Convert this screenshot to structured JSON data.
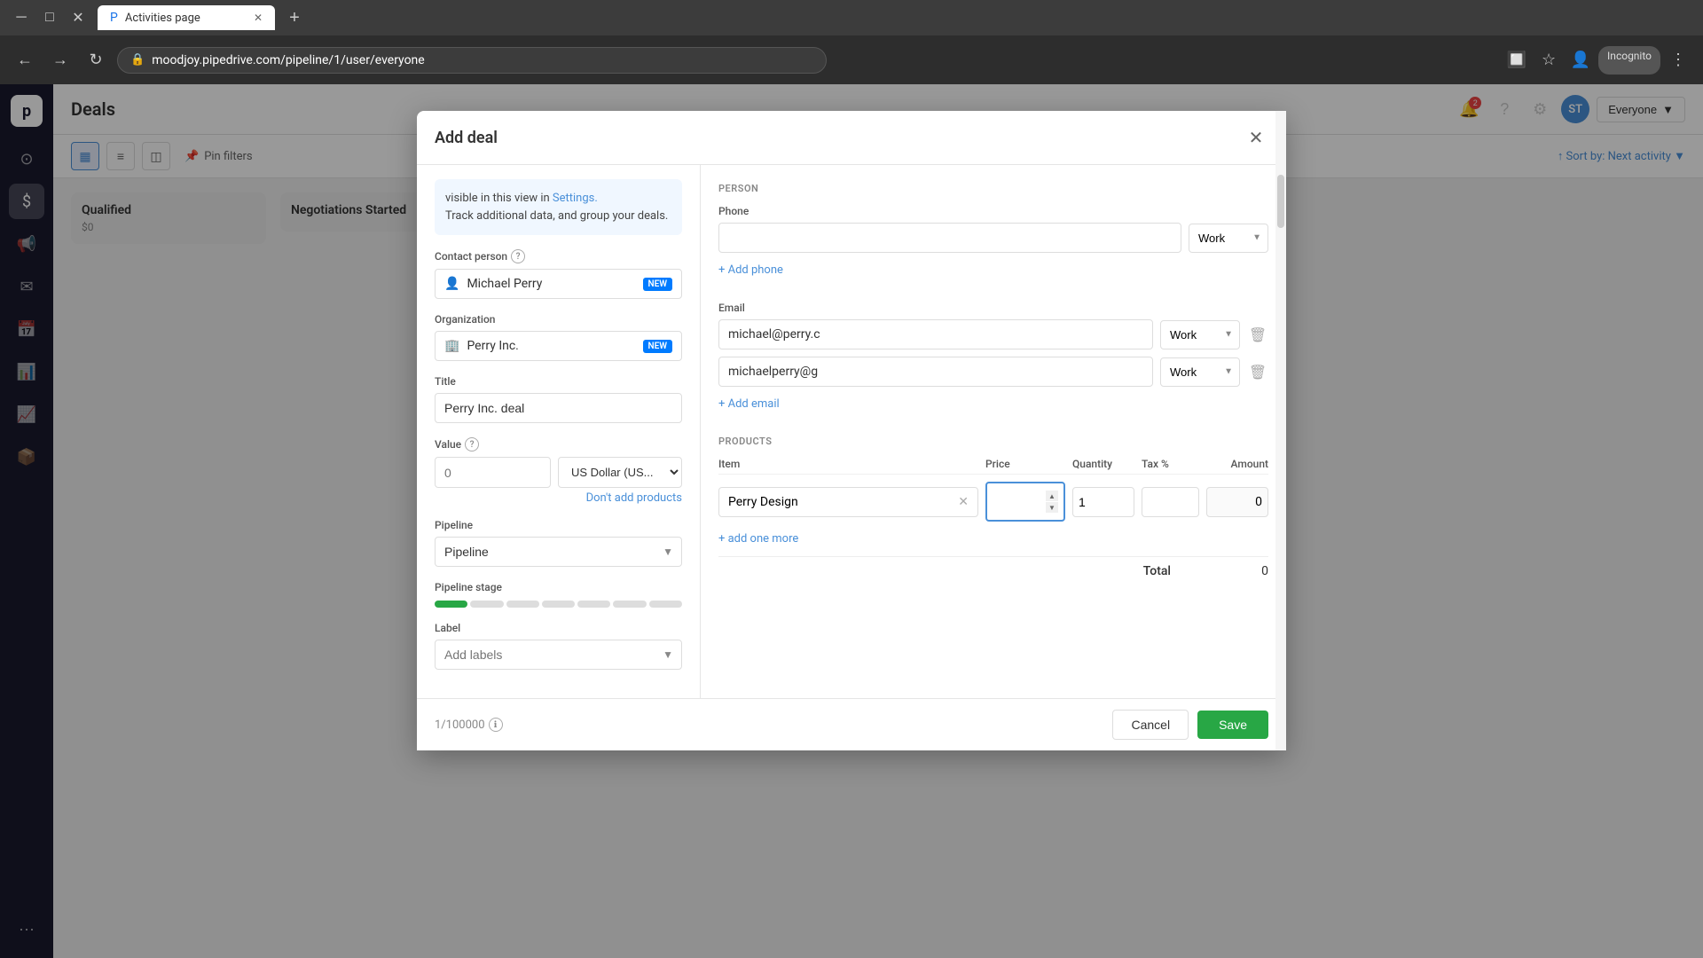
{
  "browser": {
    "url": "moodjoy.pipedrive.com/pipeline/1/user/everyone",
    "tab_title": "Activities page",
    "lock_icon": "🔒",
    "back_icon": "←",
    "forward_icon": "→",
    "refresh_icon": "↻",
    "incognito_label": "Incognito",
    "new_tab_icon": "+"
  },
  "sidebar": {
    "logo": "p",
    "items": [
      {
        "icon": "⊙",
        "label": "Home"
      },
      {
        "icon": "$",
        "label": "Deals",
        "active": true
      },
      {
        "icon": "📢",
        "label": "Activities"
      },
      {
        "icon": "✉",
        "label": "Mail"
      },
      {
        "icon": "📅",
        "label": "Calendar"
      },
      {
        "icon": "📊",
        "label": "Reports"
      },
      {
        "icon": "📈",
        "label": "Insights"
      },
      {
        "icon": "📦",
        "label": "Products"
      },
      {
        "icon": "⚙",
        "label": "Settings"
      },
      {
        "icon": "⋯",
        "label": "More"
      }
    ]
  },
  "main": {
    "title": "Deals",
    "toolbar": {
      "kanban_icon": "▦",
      "list_icon": "≡",
      "stats_icon": "◫",
      "pin_filters": "Pin filters",
      "sort_label": "Sort by: Next activity",
      "everyone_label": "Everyone",
      "edit_icon": "✎",
      "filter_icon": "⊟"
    },
    "pipeline": {
      "stage_label": "Qualified",
      "stage_amount": "$0",
      "negotiations_label": "Negotiations Started"
    }
  },
  "modal": {
    "title": "Add deal",
    "close_icon": "✕",
    "info_text": "visible in this view in ",
    "settings_link": "Settings.",
    "info_text2": "Track additional data, and group your deals.",
    "left_panel": {
      "contact_person_label": "Contact person",
      "contact_name": "Michael Perry",
      "new_badge": "NEW",
      "organization_label": "Organization",
      "org_name": "Perry Inc.",
      "org_new_badge": "NEW",
      "title_label": "Title",
      "title_value": "Perry Inc. deal",
      "value_label": "Value",
      "value_placeholder": "0",
      "currency_value": "US Dollar (US...",
      "dont_add_products": "Don't add products",
      "pipeline_label": "Pipeline",
      "pipeline_value": "Pipeline",
      "pipeline_stage_label": "Pipeline stage",
      "label_label": "Label",
      "label_placeholder": "Add labels"
    },
    "right_panel": {
      "person_section": "PERSON",
      "phone_label": "Phone",
      "phone_value": "",
      "phone_type": "Work",
      "add_phone": "+ Add phone",
      "email_label": "Email",
      "email_1": "michael@perry.c",
      "email_1_type": "Work",
      "email_2": "michaelperry@g",
      "email_2_type": "Work",
      "add_email": "+ Add email",
      "products_section": "PRODUCTS",
      "col_item": "Item",
      "col_price": "Price",
      "col_quantity": "Quantity",
      "col_tax": "Tax %",
      "col_amount": "Amount",
      "product_name": "Perry Design",
      "product_price": "",
      "product_qty": "1",
      "product_tax": "",
      "product_amount": "0",
      "add_one_more": "+ add one more",
      "total_label": "Total",
      "total_value": "0"
    },
    "footer": {
      "char_count": "1/100000",
      "info_icon": "ℹ",
      "cancel_label": "Cancel",
      "save_label": "Save"
    }
  },
  "tooltip_icon": "?"
}
